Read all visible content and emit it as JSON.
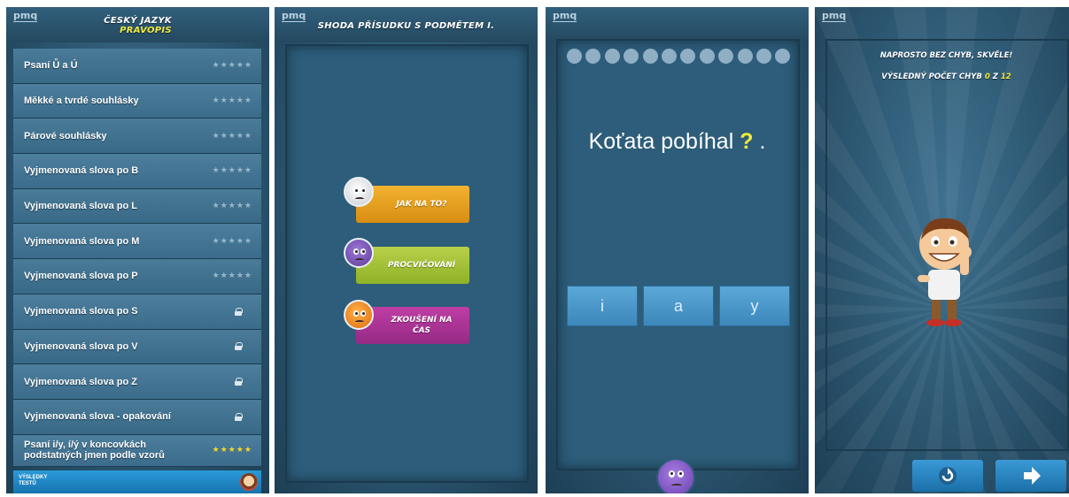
{
  "screen1": {
    "logo": "pmq",
    "title_line1": "Český jazyk",
    "title_line2": "pravopis",
    "items": [
      {
        "label": "Psaní Ů a Ú",
        "rating": "★★★★★",
        "locked": false
      },
      {
        "label": "Měkké a tvrdé souhlásky",
        "rating": "★★★★★",
        "locked": false
      },
      {
        "label": "Párové souhlásky",
        "rating": "★★★★★",
        "locked": false
      },
      {
        "label": "Vyjmenovaná slova po B",
        "rating": "★★★★★",
        "locked": false
      },
      {
        "label": "Vyjmenovaná slova po L",
        "rating": "★★★★★",
        "locked": false
      },
      {
        "label": "Vyjmenovaná slova po M",
        "rating": "★★★★★",
        "locked": false
      },
      {
        "label": "Vyjmenovaná slova po P",
        "rating": "★★★★★",
        "locked": false
      },
      {
        "label": "Vyjmenovaná slova po S",
        "rating": "",
        "locked": true
      },
      {
        "label": "Vyjmenovaná slova po V",
        "rating": "",
        "locked": true
      },
      {
        "label": "Vyjmenovaná slova po Z",
        "rating": "",
        "locked": true
      },
      {
        "label": "Vyjmenovaná slova - opakování",
        "rating": "",
        "locked": true
      },
      {
        "label": "Psaní i/y, í/ý v koncovkách podstatných jmen podle vzorů",
        "rating": "★★★★★",
        "locked": false,
        "gold": true
      }
    ],
    "footer_label": "VÝSLEDKY TESTŮ"
  },
  "screen2": {
    "logo": "pmq",
    "title": "Shoda přísudku s podmětem I.",
    "buttons": {
      "how": "Jak na to?",
      "practice": "Procvičování",
      "exam": "Zkoušení na čas"
    }
  },
  "screen3": {
    "logo": "pmq",
    "progress_total": 12,
    "question_text": "Koťata pobíhal",
    "question_blank": "?",
    "question_end": ".",
    "answers": [
      "i",
      "a",
      "y"
    ]
  },
  "screen4": {
    "logo": "pmq",
    "message": "Naprosto bez chyb, skvěle!",
    "result_prefix": "Výsledný počet chyb",
    "errors": "0",
    "result_of": "z",
    "total": "12"
  },
  "colors": {
    "accent_yellow": "#f0ea3c",
    "orange_button": "#e59c1d",
    "green_button": "#a6c236",
    "purple_button": "#aa3595",
    "answer_blue": "#4b97c9"
  }
}
